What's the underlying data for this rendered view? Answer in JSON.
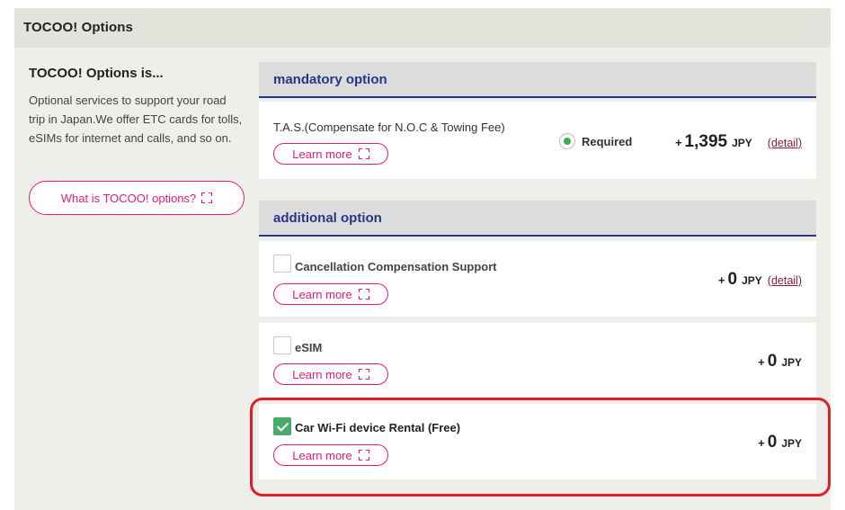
{
  "panel": {
    "title": "TOCOO! Options"
  },
  "intro": {
    "title": "TOCOO! Options is...",
    "text": "Optional services to support your road trip in Japan.We offer ETC cards for tolls, eSIMs for internet and calls, and so on.",
    "what_button": "What is TOCOO! options?"
  },
  "mandatory": {
    "heading": "mandatory option",
    "option": {
      "name": "T.A.S.(Compensate for N.O.C & Towing Fee)",
      "learn_more": "Learn more",
      "status": "Required",
      "price_prefix": "+",
      "price": "1,395",
      "currency": "JPY",
      "detail": "(detail)"
    }
  },
  "additional": {
    "heading": "additional option",
    "options": [
      {
        "name": "Cancellation Compensation Support",
        "learn_more": "Learn more",
        "checked": false,
        "price_prefix": "+",
        "price": "0",
        "currency": "JPY",
        "detail": "(detail)"
      },
      {
        "name": "eSIM",
        "learn_more": "Learn more",
        "checked": false,
        "price_prefix": "+",
        "price": "0",
        "currency": "JPY"
      },
      {
        "name": "Car Wi-Fi device Rental (Free)",
        "learn_more": "Learn more",
        "checked": true,
        "price_prefix": "+",
        "price": "0",
        "currency": "JPY"
      }
    ]
  },
  "colors": {
    "accent": "#e6197a",
    "heading": "#263688",
    "checked": "#4aa96c",
    "highlight": "#e01e26"
  },
  "icons": {
    "learn_more": "expand-icon",
    "required": "radio-selected-icon",
    "checked": "checkmark-icon"
  }
}
